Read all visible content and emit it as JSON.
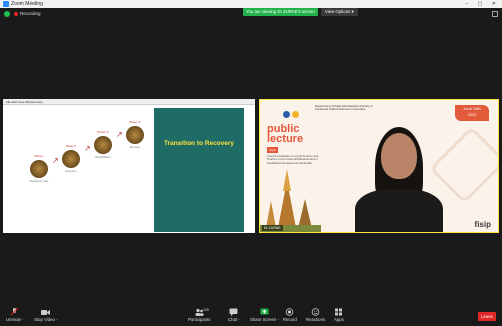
{
  "window": {
    "title": "Zoom Meeting"
  },
  "topbar": {
    "recording_label": "Recording",
    "viewing_banner": "You are viewing Dr ZURAE's screen",
    "view_options_label": "View Options"
  },
  "shared_screen": {
    "menu_text": "File  Edit  View  Window  Help",
    "slide_title": "Transition to Recovery",
    "phases": [
      {
        "label": "Phase I",
        "text": "Emergency relief"
      },
      {
        "label": "Phase II",
        "text": "Response"
      },
      {
        "label": "Phase III",
        "text": "Rehabilitation"
      },
      {
        "label": "Phase IV",
        "text": "Recovery"
      }
    ]
  },
  "video": {
    "public_label": "public",
    "lecture_label": "lecture",
    "badge": "Topic",
    "talk_text": "Current Limitations on Covid Tourism and Tourism in the Covid-19 Pandemic Era in Southeast Indonesia and Cambodia",
    "date_line1": "June 26th",
    "date_line2": "2022",
    "dept_text": "Department of Public Administration Faculty of Social and Political Sciences Universitas",
    "brand": "fisip",
    "participant_name": "Dr ZURAE"
  },
  "toolbar": {
    "unmute": "Unmute",
    "stop_video": "Stop Video",
    "participants": "Participants",
    "participants_count": "109",
    "chat": "Chat",
    "share_screen": "Share Screen",
    "record": "Record",
    "reactions": "Reactions",
    "apps": "Apps",
    "leave": "Leave"
  },
  "colors": {
    "viewing_banner": "#23b24b",
    "slide_panel": "#1f6b66",
    "slide_title": "#ffe23a",
    "lecture_accent": "#e5563b",
    "leave": "#e02828"
  }
}
